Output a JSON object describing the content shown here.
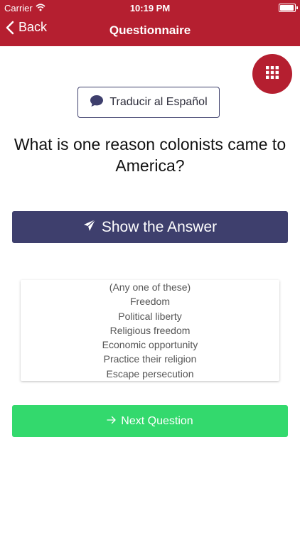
{
  "status_bar": {
    "carrier": "Carrier",
    "time": "10:19 PM"
  },
  "nav": {
    "back_label": "Back",
    "title": "Questionnaire"
  },
  "translate_label": "Traducir al Español",
  "question": "What is one reason colonists came to America?",
  "show_answer_label": "Show the Answer",
  "answer": {
    "intro": "(Any one of these)",
    "items": [
      "Freedom",
      "Political liberty",
      "Religious freedom",
      "Economic opportunity",
      "Practice their religion",
      "Escape persecution"
    ]
  },
  "next_label": "Next Question",
  "colors": {
    "header": "#b51f30",
    "primary_button": "#3e3f6d",
    "next_button": "#33d96d"
  },
  "icons": {
    "back": "chevron-left-icon",
    "grid": "grid-icon",
    "translate": "chat-bubble-icon",
    "show_answer": "paper-plane-icon",
    "next": "arrow-right-icon"
  }
}
